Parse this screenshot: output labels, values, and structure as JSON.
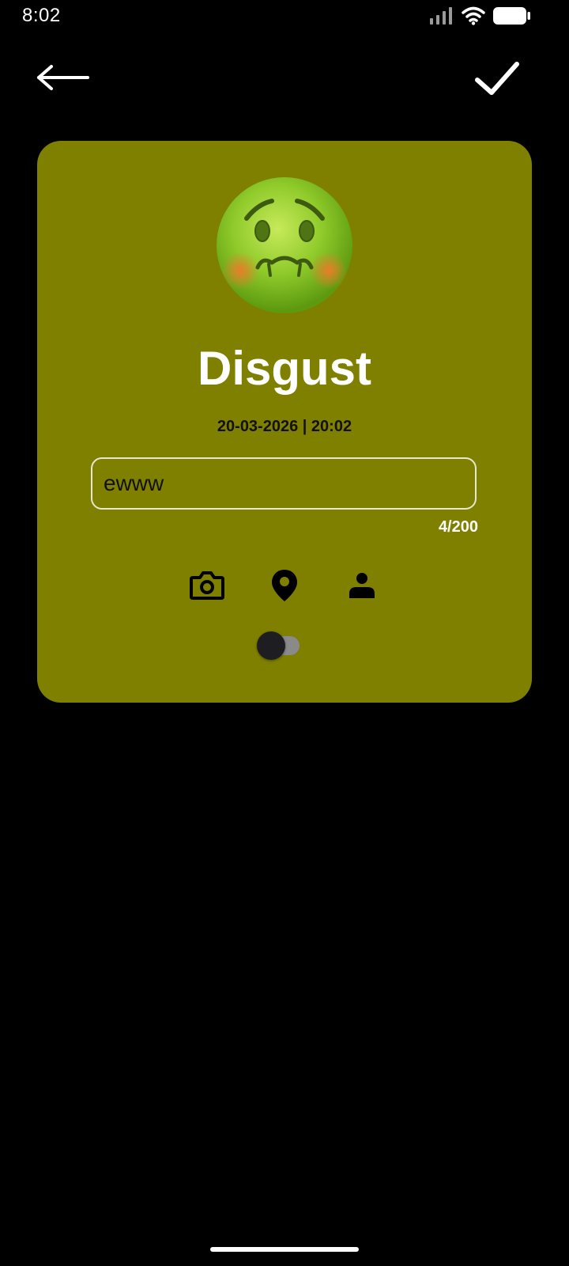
{
  "status_bar": {
    "time": "8:02"
  },
  "app_bar": {
    "back_icon": "arrow-left-icon",
    "confirm_icon": "checkmark-icon"
  },
  "mood": {
    "emoji_icon": "nauseated-face-icon",
    "title": "Disgust",
    "datetime": "20-03-2026 | 20:02",
    "card_color": "#7f7f00"
  },
  "note": {
    "value": "ewww",
    "counter": "4/200"
  },
  "attachments": [
    {
      "icon": "camera-icon"
    },
    {
      "icon": "location-pin-icon"
    },
    {
      "icon": "person-icon"
    }
  ],
  "toggle": {
    "state": "off"
  }
}
